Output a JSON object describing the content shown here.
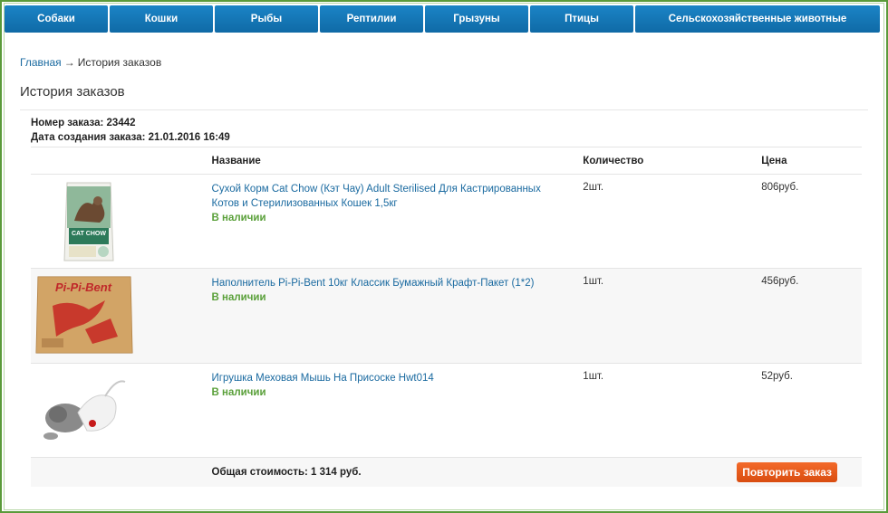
{
  "nav": {
    "items": [
      {
        "label": "Собаки"
      },
      {
        "label": "Кошки"
      },
      {
        "label": "Рыбы"
      },
      {
        "label": "Рептилии"
      },
      {
        "label": "Грызуны"
      },
      {
        "label": "Птицы"
      },
      {
        "label": "Сельскохозяйственные животные"
      }
    ]
  },
  "breadcrumb": {
    "home": "Главная",
    "separator": "→",
    "current": "История заказов"
  },
  "page": {
    "title": "История заказов"
  },
  "order": {
    "number_line": "Номер заказа: 23442",
    "date_line": "Дата создания заказа: 21.01.2016 16:49",
    "columns": {
      "name": "Название",
      "qty": "Количество",
      "price": "Цена"
    },
    "items": [
      {
        "name": "Сухой Корм Cat Chow (Кэт Чау) Adult Sterilised Для Кастрированных Котов и Стерилизованных Кошек 1,5кг",
        "stock": "В наличии",
        "qty": "2шт.",
        "price": "806руб.",
        "image_icon": "cat-food-bag-icon",
        "image_text": "CAT CHOW"
      },
      {
        "name": "Наполнитель Pi-Pi-Bent 10кг Классик Бумажный Крафт-Пакет (1*2)",
        "stock": "В наличии",
        "qty": "1шт.",
        "price": "456руб.",
        "image_icon": "litter-bag-icon",
        "image_text": "Pi-Pi-Bent"
      },
      {
        "name": "Игрушка Меховая Мышь На Присоске Hwt014",
        "stock": "В наличии",
        "qty": "1шт.",
        "price": "52руб.",
        "image_icon": "toy-mouse-icon"
      }
    ],
    "total": "Общая стоимость: 1 314 руб.",
    "repeat_button": "Повторить заказ"
  },
  "colors": {
    "nav_blue": "#1479bb",
    "link_blue": "#1a6aa0",
    "in_stock_green": "#5aa03a",
    "button_orange": "#e85a1c",
    "frame_green": "#5a9a3a"
  }
}
